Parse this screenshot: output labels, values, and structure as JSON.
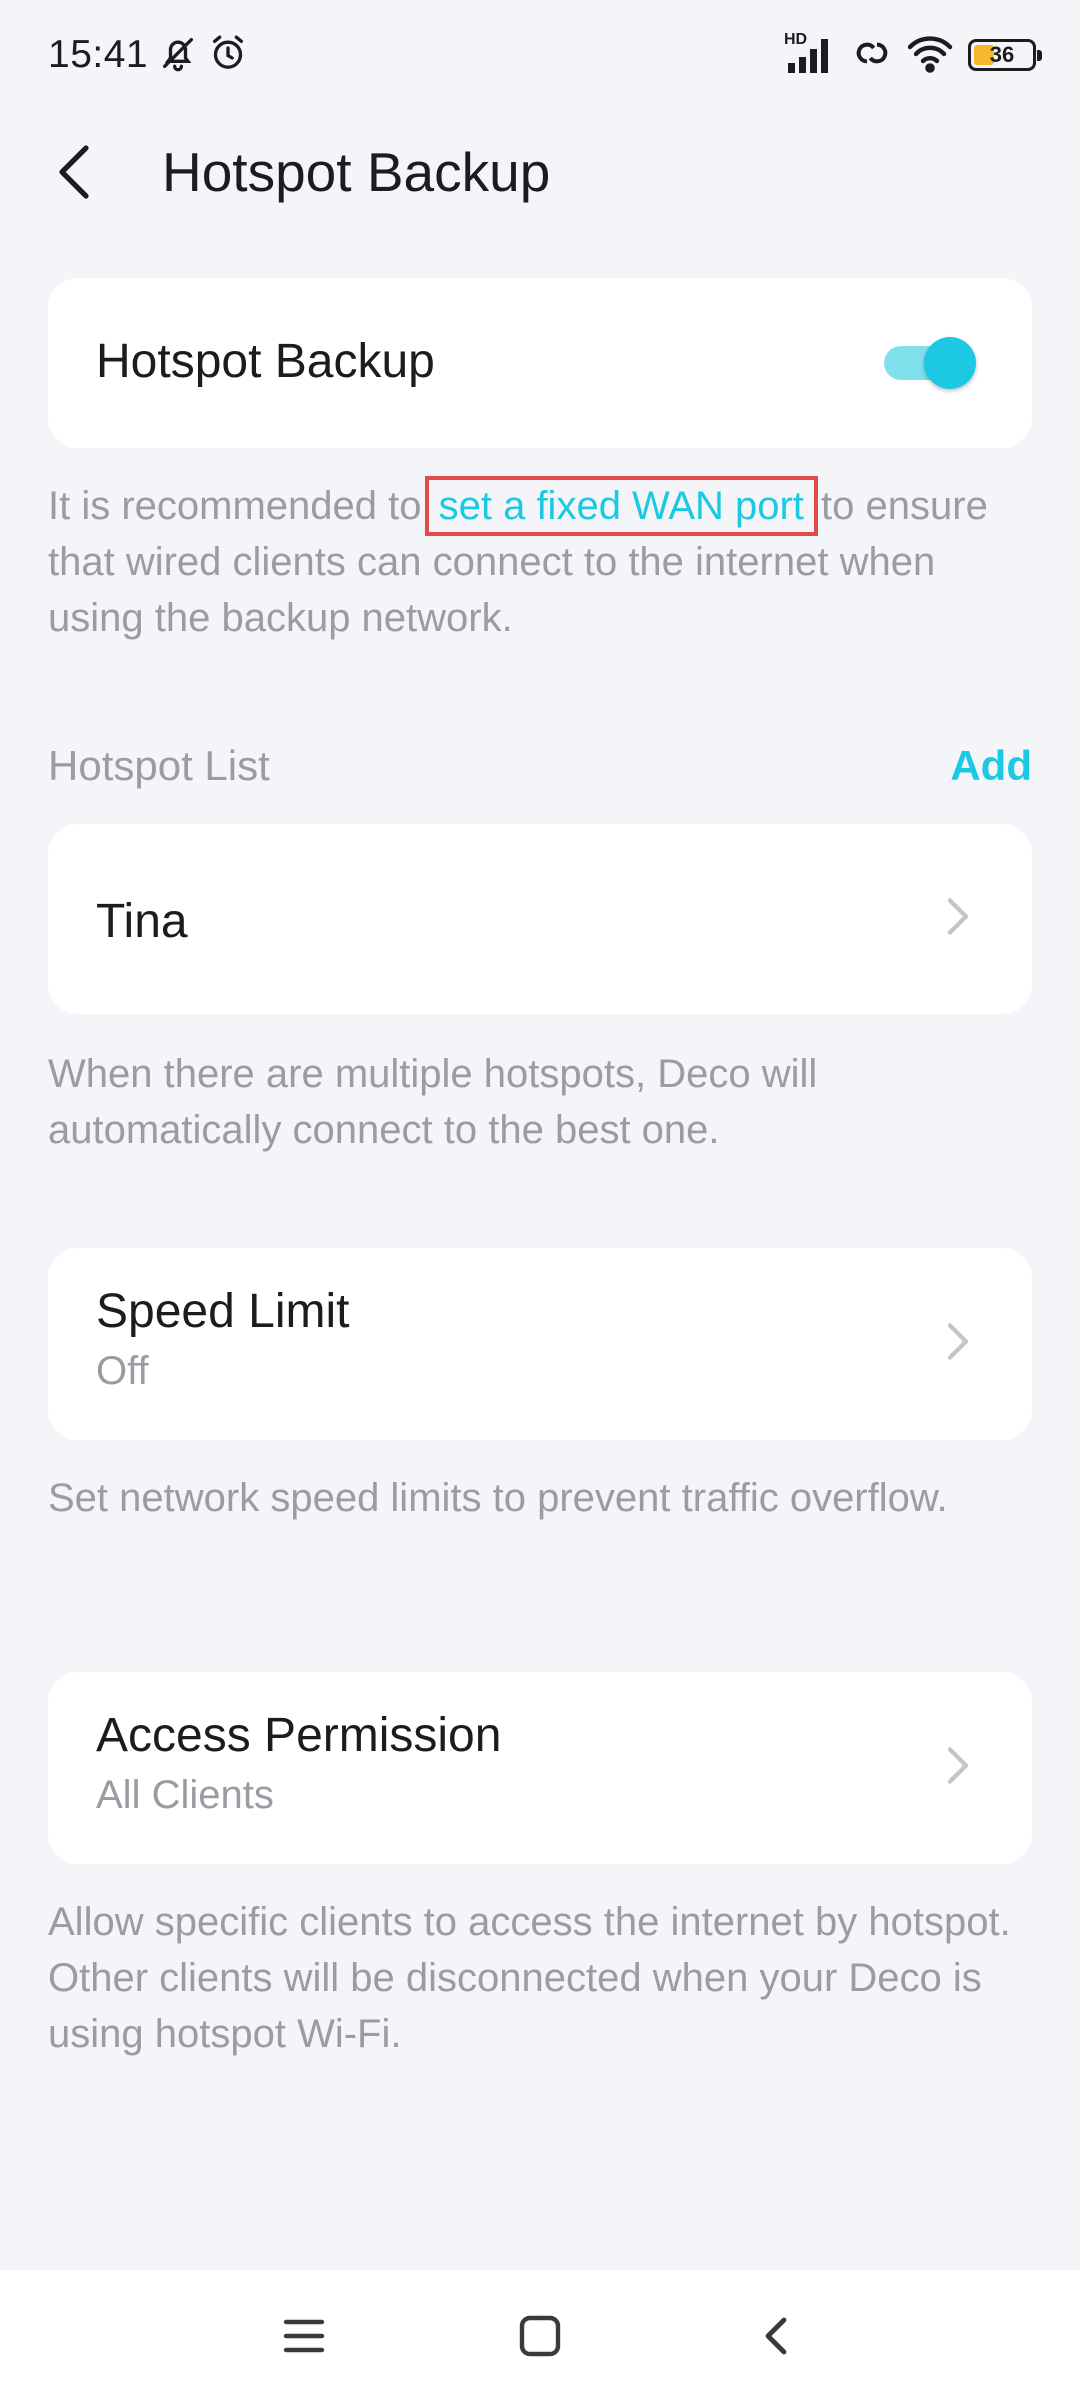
{
  "status_bar": {
    "time": "15:41",
    "network_badge": "HD",
    "battery_level": "36"
  },
  "header": {
    "title": "Hotspot Backup"
  },
  "hotspot_backup": {
    "label": "Hotspot Backup",
    "enabled": true,
    "note_before": "It is recommended to ",
    "note_link": "set a fixed WAN port",
    "note_after": " to ensure that wired clients can connect to the internet when using the backup network."
  },
  "hotspot_list": {
    "title": "Hotspot List",
    "add_label": "Add",
    "items": [
      {
        "name": "Tina"
      }
    ],
    "note": "When there are multiple hotspots, Deco will automatically connect to the best one."
  },
  "speed_limit": {
    "title": "Speed Limit",
    "value": "Off",
    "note": "Set network speed limits to prevent traffic overflow."
  },
  "access_permission": {
    "title": "Access Permission",
    "value": "All Clients",
    "note": "Allow specific clients to access the internet by hotspot. Other clients will be disconnected when your Deco is using hotspot Wi-Fi."
  },
  "colors": {
    "accent": "#1cc9e2",
    "background": "#f4f5f9",
    "muted_text": "#9b9ca3",
    "highlight_box": "#e34a4a"
  }
}
